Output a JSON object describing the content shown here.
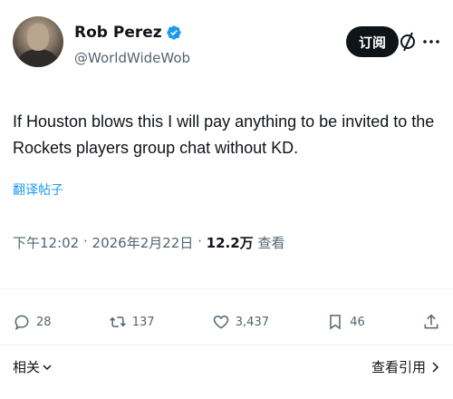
{
  "author": {
    "display_name": "Rob Perez",
    "handle": "@WorldWideWob"
  },
  "header": {
    "subscribe_label": "订阅"
  },
  "tweet": {
    "text": "If Houston blows this I will pay anything to be invited to the Rockets players group chat without KD.",
    "translate_label": "翻译帖子",
    "time": "下午12:02",
    "date": "2026年2月22日",
    "views_count": "12.2万",
    "views_label": "查看",
    "separator": " · "
  },
  "actions": {
    "replies": "28",
    "reposts": "137",
    "likes": "3,437",
    "bookmarks": "46"
  },
  "footer": {
    "related_label": "相关",
    "quotes_label": "查看引用"
  },
  "colors": {
    "accent": "#1d9bf0",
    "text": "#0f1419",
    "muted": "#536471"
  }
}
